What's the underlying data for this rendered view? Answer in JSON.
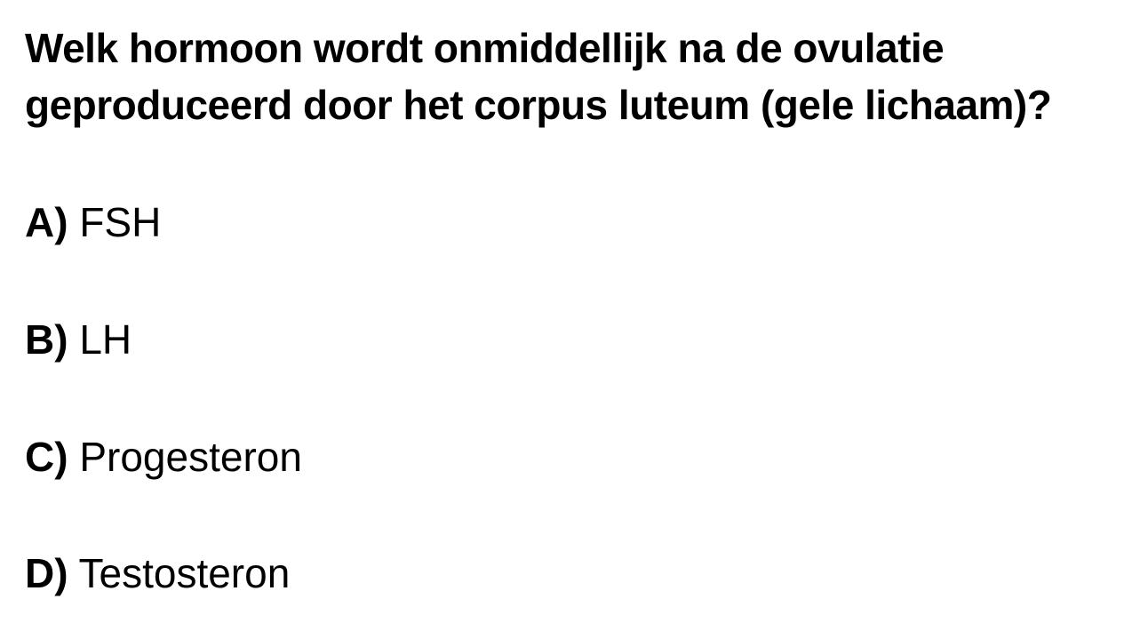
{
  "question": {
    "line1": "Welk hormoon wordt onmiddellijk na de ovulatie",
    "line2": "geproduceerd door het corpus luteum (gele lichaam)?"
  },
  "options": [
    {
      "letter": "A)",
      "text": "FSH"
    },
    {
      "letter": "B)",
      "text": "LH"
    },
    {
      "letter": "C)",
      "text": "Progesteron"
    },
    {
      "letter": "D)",
      "text": "Testosteron"
    }
  ]
}
